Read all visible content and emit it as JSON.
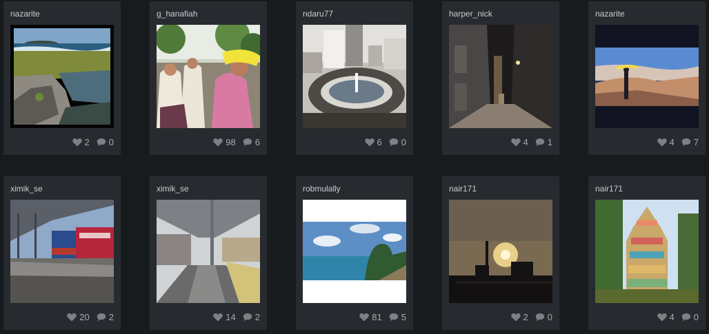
{
  "colors": {
    "background": "#181b1e",
    "card": "#272b2f",
    "username": "#c9cdd1",
    "stat": "#a7acb1",
    "icon": "#7c8186"
  },
  "cards": [
    {
      "user": "nazarite",
      "likes": "2",
      "comments": "0",
      "scene": "coast-rocks",
      "has_frame": true
    },
    {
      "user": "g_hanafiah",
      "likes": "98",
      "comments": "6",
      "scene": "crowd-parade"
    },
    {
      "user": "ndaru77",
      "likes": "6",
      "comments": "0",
      "scene": "city-roundabout"
    },
    {
      "user": "harper_nick",
      "likes": "4",
      "comments": "1",
      "scene": "night-alley"
    },
    {
      "user": "nazarite",
      "likes": "4",
      "comments": "7",
      "scene": "person-rocks-sunset"
    },
    {
      "user": "ximik_se",
      "likes": "20",
      "comments": "2",
      "scene": "train-station"
    },
    {
      "user": "ximik_se",
      "likes": "14",
      "comments": "2",
      "scene": "platform-canopy"
    },
    {
      "user": "robmulally",
      "likes": "81",
      "comments": "5",
      "scene": "sea-cliff"
    },
    {
      "user": "nair171",
      "likes": "2",
      "comments": "0",
      "scene": "sunset-silhouette"
    },
    {
      "user": "nair171",
      "likes": "4",
      "comments": "0",
      "scene": "temple-tower"
    }
  ]
}
